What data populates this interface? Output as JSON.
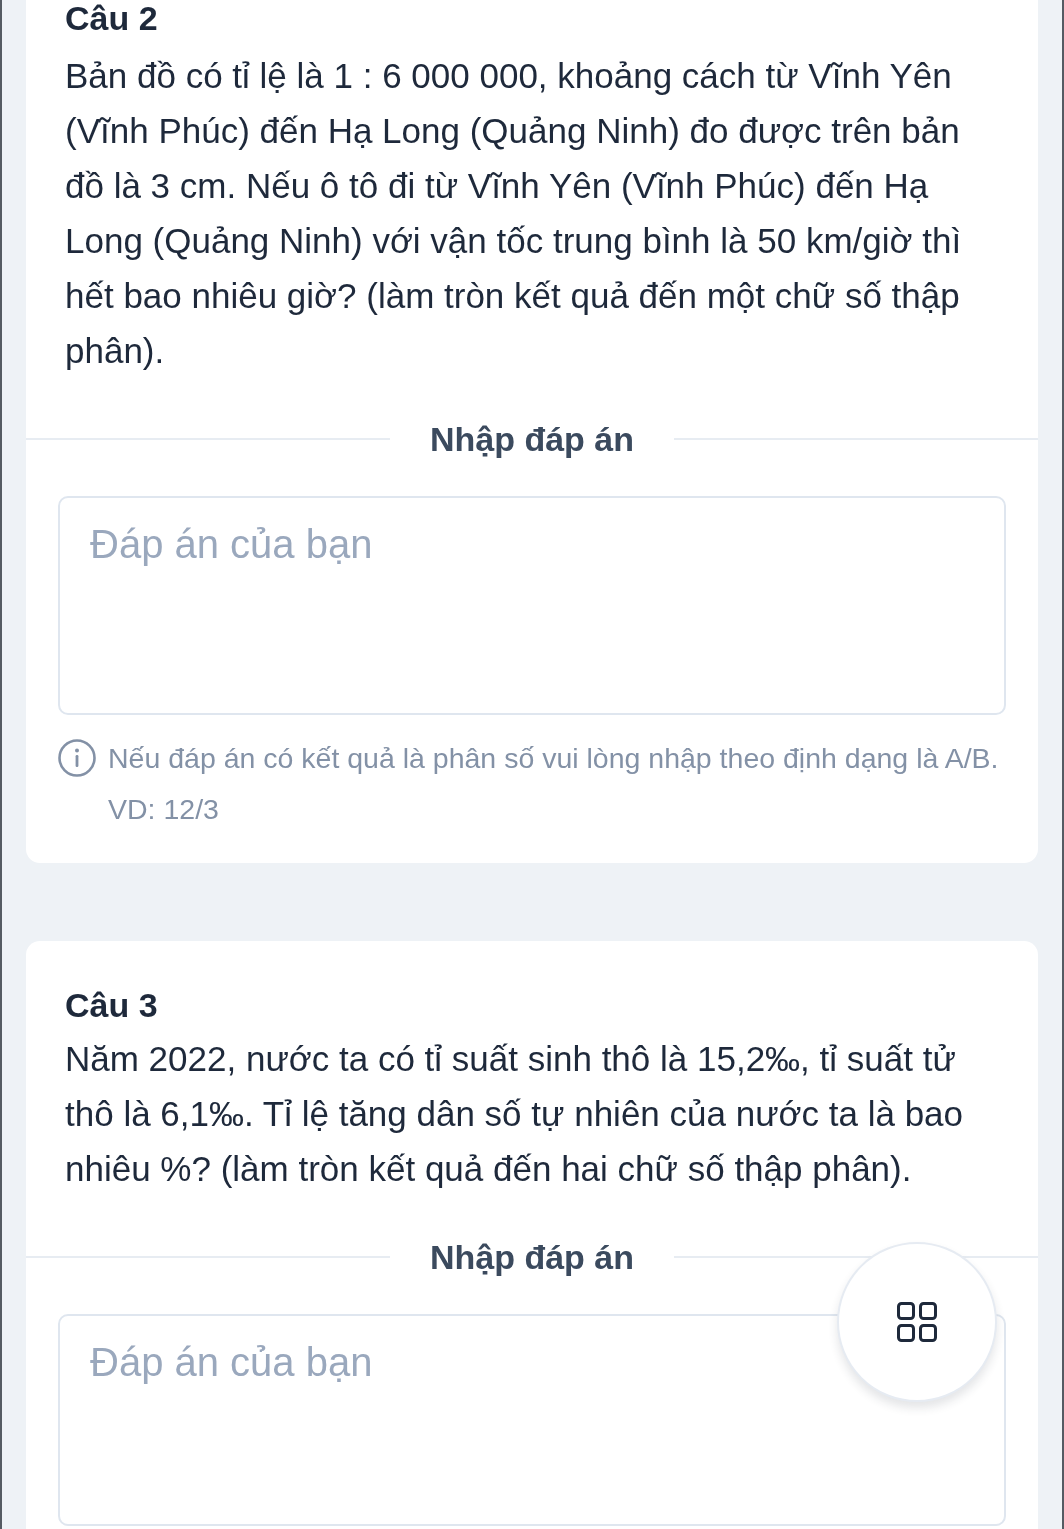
{
  "questions": [
    {
      "title": "Câu 2",
      "text": "Bản đồ có tỉ lệ là 1 : 6 000 000, khoảng cách từ Vĩnh Yên (Vĩnh Phúc) đến Hạ Long (Quảng Ninh) đo được trên bản đồ là 3 cm. Nếu ô tô đi từ Vĩnh Yên (Vĩnh Phúc) đến Hạ Long (Quảng Ninh) với vận tốc trung bình là 50 km/giờ thì hết bao nhiêu giờ? (làm tròn kết quả đến một chữ số thập phân).",
      "answer_heading": "Nhập đáp án",
      "answer_field": {
        "placeholder": "Đáp án của bạn"
      },
      "hint": "Nếu đáp án có kết quả là phân số vui lòng nhập theo định dạng là A/B. VD: 12/3"
    },
    {
      "title": "Câu 3",
      "text": "Năm 2022, nước ta có tỉ suất sinh thô là 15,2‰, tỉ suất tử thô là 6,1‰. Tỉ lệ tăng dân số tự nhiên của nước ta là bao nhiêu %? (làm tròn kết quả đến hai chữ số thập phân).",
      "answer_heading": "Nhập đáp án",
      "answer_field": {
        "placeholder": "Đáp án của bạn"
      }
    }
  ]
}
